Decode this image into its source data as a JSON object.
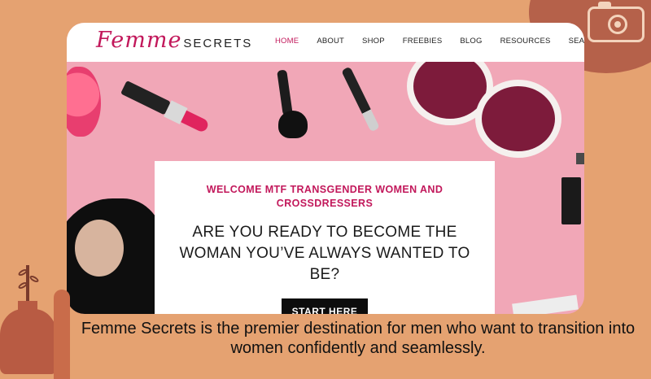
{
  "logo": {
    "script": "Femme",
    "caps": "SECRETS"
  },
  "nav": {
    "items": [
      {
        "label": "HOME",
        "active": true
      },
      {
        "label": "ABOUT"
      },
      {
        "label": "SHOP"
      },
      {
        "label": "FREEBIES"
      },
      {
        "label": "BLOG"
      },
      {
        "label": "RESOURCES"
      },
      {
        "label": "SEARCH"
      }
    ]
  },
  "hero": {
    "kicker": "WELCOME MTF TRANSGENDER WOMEN AND CROSSDRESSERS",
    "headline": "ARE YOU READY TO BECOME THE WOMAN YOU’VE ALWAYS WANTED TO BE?",
    "cta_label": "START HERE"
  },
  "caption": "Femme Secrets is the premier destination for men who want to transition into women confidently and seamlessly.",
  "icons": [
    "camera-icon"
  ],
  "colors": {
    "accent": "#c2185b",
    "background": "#e5a271",
    "hero_pink": "#f1a7b7"
  }
}
